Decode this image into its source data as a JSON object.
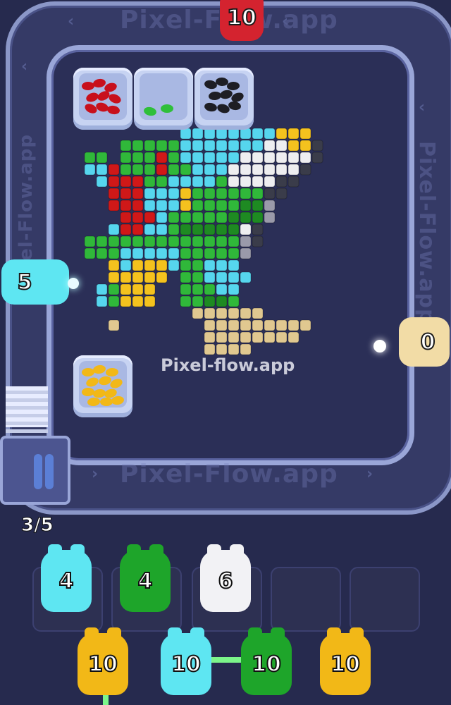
{
  "watermark": {
    "text": "Pixel-Flow.app",
    "center_text": "Pixel-flow.app"
  },
  "counter": "3/5",
  "top_shooter": {
    "value": "10",
    "color": "#d4232f"
  },
  "left_shooter": {
    "value": "5",
    "color": "#5ee6f2"
  },
  "right_shooter": {
    "value": "0",
    "color": "#f2dca6"
  },
  "bins": [
    {
      "color": "#c8101c",
      "name": "red"
    },
    {
      "color": "#2fbf3a",
      "name": "green"
    },
    {
      "color": "#1e1e24",
      "name": "black"
    },
    {
      "color": "#f2b817",
      "name": "yellow"
    }
  ],
  "queue": [
    {
      "value": "4",
      "color": "#5ee6f2"
    },
    {
      "value": "4",
      "color": "#1ea52a"
    },
    {
      "value": "6",
      "color": "#f2f2f5"
    }
  ],
  "reserve": [
    {
      "value": "10",
      "color": "#f2b817"
    },
    {
      "value": "10",
      "color": "#5ee6f2"
    },
    {
      "value": "10",
      "color": "#1ea52a"
    },
    {
      "value": "10",
      "color": "#f2b817"
    }
  ]
}
